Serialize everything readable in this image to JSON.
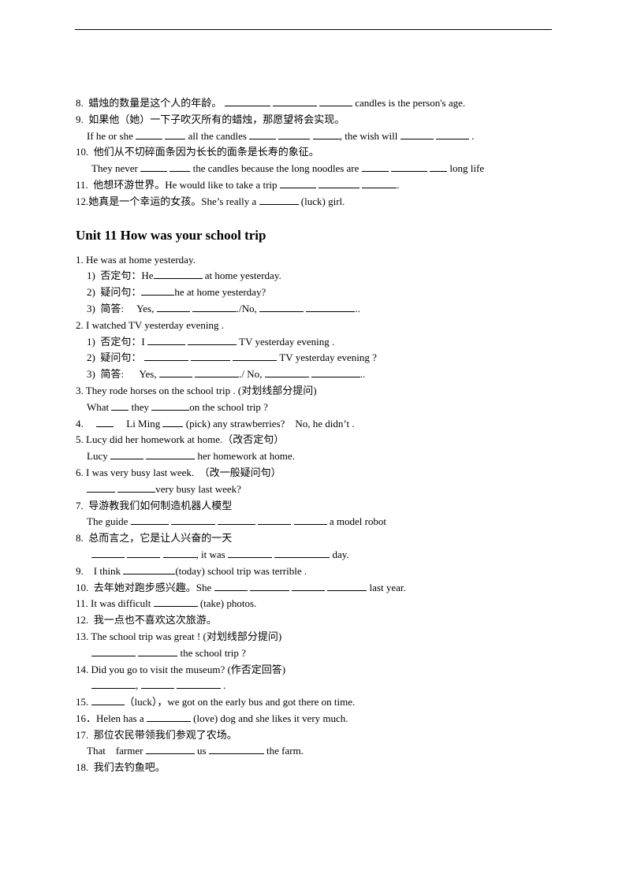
{
  "section_title": "Unit 11 How was your school trip",
  "part1": [
    {
      "indent": 0,
      "segs": [
        {
          "t": "8.  蜡烛的数量是这个人的年龄。 "
        },
        {
          "b": 58
        },
        {
          "t": " "
        },
        {
          "b": 56
        },
        {
          "t": " "
        },
        {
          "b": 42
        },
        {
          "t": " candles is the person's age."
        }
      ]
    },
    {
      "indent": 0,
      "segs": [
        {
          "t": "9.  如果他（她）一下子吹灭所有的蜡烛，那愿望将会实现。"
        }
      ]
    },
    {
      "indent": 1,
      "segs": [
        {
          "t": "If he or she "
        },
        {
          "b": 34
        },
        {
          "t": " "
        },
        {
          "b": 26
        },
        {
          "t": " all the candles "
        },
        {
          "b": 34
        },
        {
          "t": " "
        },
        {
          "b": 40
        },
        {
          "t": " "
        },
        {
          "b": 34
        },
        {
          "t": ", the wish will "
        },
        {
          "b": 42
        },
        {
          "t": " "
        },
        {
          "b": 42
        },
        {
          "t": " ."
        }
      ]
    },
    {
      "indent": 0,
      "segs": [
        {
          "t": "10.  他们从不切碎面条因为长长的面条是长寿的象征。"
        }
      ]
    },
    {
      "indent": 2,
      "segs": [
        {
          "t": "They never "
        },
        {
          "b": 34
        },
        {
          "t": " "
        },
        {
          "b": 26
        },
        {
          "t": " the candles because the long noodles are "
        },
        {
          "b": 34
        },
        {
          "t": " "
        },
        {
          "b": 46
        },
        {
          "t": " "
        },
        {
          "b": 22
        },
        {
          "t": " long life"
        }
      ]
    },
    {
      "indent": 0,
      "segs": [
        {
          "t": "11.  他想环游世界。He would like to take a trip "
        },
        {
          "b": 46
        },
        {
          "t": " "
        },
        {
          "b": 52
        },
        {
          "t": " "
        },
        {
          "b": 44
        },
        {
          "t": "."
        }
      ]
    },
    {
      "indent": 0,
      "segs": [
        {
          "t": "12.她真是一个幸运的女孩。She’s really a "
        },
        {
          "b": 50
        },
        {
          "t": " (luck) girl."
        }
      ]
    }
  ],
  "part2": [
    {
      "indent": 0,
      "segs": [
        {
          "t": "1. He was at home yesterday."
        }
      ]
    },
    {
      "indent": 1,
      "segs": [
        {
          "t": "1)  否定句：He"
        },
        {
          "b": 62
        },
        {
          "t": " at home yesterday."
        }
      ]
    },
    {
      "indent": 1,
      "segs": [
        {
          "t": "2)  疑问句："
        },
        {
          "b": 42
        },
        {
          "t": "he at home yesterday?"
        }
      ]
    },
    {
      "indent": 1,
      "segs": [
        {
          "t": "3)  简答:     Yes, "
        },
        {
          "b": 42
        },
        {
          "t": " "
        },
        {
          "b": 56
        },
        {
          "t": "./No, "
        },
        {
          "b": 56
        },
        {
          "t": " "
        },
        {
          "b": 62
        },
        {
          "t": ".."
        }
      ]
    },
    {
      "indent": 0,
      "segs": [
        {
          "t": "2. I watched TV yesterday evening ."
        }
      ]
    },
    {
      "indent": 1,
      "segs": [
        {
          "t": "1)  否定句：I "
        },
        {
          "b": 48
        },
        {
          "t": " "
        },
        {
          "b": 62
        },
        {
          "t": " TV yesterday evening ."
        }
      ]
    },
    {
      "indent": 1,
      "segs": [
        {
          "t": "2)  疑问句： "
        },
        {
          "b": 56
        },
        {
          "t": " "
        },
        {
          "b": 50
        },
        {
          "t": " "
        },
        {
          "b": 56
        },
        {
          "t": " TV yesterday evening ?"
        }
      ]
    },
    {
      "indent": 1,
      "segs": [
        {
          "t": "3)  简答:      Yes, "
        },
        {
          "b": 42
        },
        {
          "t": " "
        },
        {
          "b": 56
        },
        {
          "t": "./ No, "
        },
        {
          "b": 56
        },
        {
          "t": " "
        },
        {
          "b": 62
        },
        {
          "t": ".."
        }
      ]
    },
    {
      "indent": 0,
      "segs": [
        {
          "t": "3. They rode horses on the school trip . (对划线部分提问)"
        }
      ]
    },
    {
      "indent": 1,
      "segs": [
        {
          "t": "What "
        },
        {
          "b": 22
        },
        {
          "t": " they "
        },
        {
          "b": 48
        },
        {
          "t": "on the school trip ?"
        }
      ]
    },
    {
      "indent": 0,
      "segs": [
        {
          "t": "4.     "
        },
        {
          "b": 22
        },
        {
          "t": "     Li Ming "
        },
        {
          "b": 26
        },
        {
          "t": " (pick) any strawberries?    No, he didn’t ."
        }
      ]
    },
    {
      "indent": 0,
      "segs": [
        {
          "t": "5. Lucy did her homework at home.（改否定句）"
        }
      ]
    },
    {
      "indent": 1,
      "segs": [
        {
          "t": "Lucy "
        },
        {
          "b": 42
        },
        {
          "t": " "
        },
        {
          "b": 62
        },
        {
          "t": " her homework at home."
        }
      ]
    },
    {
      "indent": 0,
      "segs": [
        {
          "t": "6. I was very busy last week.  （改一般疑问句）"
        }
      ]
    },
    {
      "indent": 1,
      "segs": [
        {
          "t": ""
        },
        {
          "b": 36
        },
        {
          "t": " "
        },
        {
          "b": 48
        },
        {
          "t": "very busy last week?"
        }
      ]
    },
    {
      "indent": 0,
      "segs": [
        {
          "t": "7.  导游教我们如何制造机器人模型"
        }
      ]
    },
    {
      "indent": 1,
      "segs": [
        {
          "t": "The guide "
        },
        {
          "b": 48
        },
        {
          "t": " "
        },
        {
          "b": 56
        },
        {
          "t": " "
        },
        {
          "b": 48
        },
        {
          "t": " "
        },
        {
          "b": 42
        },
        {
          "t": " "
        },
        {
          "b": 42
        },
        {
          "t": " a model robot"
        }
      ]
    },
    {
      "indent": 0,
      "segs": [
        {
          "t": "8.  总而言之，它是让人兴奋的一天"
        }
      ]
    },
    {
      "indent": 2,
      "segs": [
        {
          "t": ""
        },
        {
          "b": 42
        },
        {
          "t": " "
        },
        {
          "b": 42
        },
        {
          "t": " "
        },
        {
          "b": 42
        },
        {
          "t": ", it was "
        },
        {
          "b": 56
        },
        {
          "t": " "
        },
        {
          "b": 70
        },
        {
          "t": " day."
        }
      ]
    },
    {
      "indent": 0,
      "segs": [
        {
          "t": "9.    I think "
        },
        {
          "b": 66
        },
        {
          "t": "(today) school trip was terrible ."
        }
      ]
    },
    {
      "indent": 0,
      "segs": [
        {
          "t": "10.  去年她对跑步感兴趣。She "
        },
        {
          "b": 42
        },
        {
          "t": " "
        },
        {
          "b": 50
        },
        {
          "t": " "
        },
        {
          "b": 42
        },
        {
          "t": " "
        },
        {
          "b": 50
        },
        {
          "t": " last year."
        }
      ]
    },
    {
      "indent": 0,
      "segs": [
        {
          "t": "11. It was difficult "
        },
        {
          "b": 56
        },
        {
          "t": " (take) photos."
        }
      ]
    },
    {
      "indent": 0,
      "segs": [
        {
          "t": "12.  我一点也不喜欢这次旅游。"
        }
      ]
    },
    {
      "indent": 0,
      "segs": [
        {
          "t": "13. The school trip was great ! (对划线部分提问)"
        }
      ]
    },
    {
      "indent": 2,
      "segs": [
        {
          "t": ""
        },
        {
          "b": 56
        },
        {
          "t": " "
        },
        {
          "b": 50
        },
        {
          "t": " the school trip ?"
        }
      ]
    },
    {
      "indent": 0,
      "segs": [
        {
          "t": "14. Did you go to visit the museum? (作否定回答)"
        }
      ]
    },
    {
      "indent": 2,
      "segs": [
        {
          "t": ""
        },
        {
          "b": 56
        },
        {
          "t": ", "
        },
        {
          "b": 42
        },
        {
          "t": " "
        },
        {
          "b": 56
        },
        {
          "t": " ."
        }
      ]
    },
    {
      "indent": 0,
      "segs": [
        {
          "t": "15. "
        },
        {
          "b": 42
        },
        {
          "t": "（luck），we got on the early bus and got there on time."
        }
      ]
    },
    {
      "indent": 0,
      "segs": [
        {
          "t": "16．Helen has a "
        },
        {
          "b": 56
        },
        {
          "t": " (love) dog and she likes it very much."
        }
      ]
    },
    {
      "indent": 0,
      "segs": [
        {
          "t": "17.  那位农民带领我们参观了农场。"
        }
      ]
    },
    {
      "indent": 1,
      "segs": [
        {
          "t": "That    farmer "
        },
        {
          "b": 62
        },
        {
          "t": " us "
        },
        {
          "b": 70
        },
        {
          "t": " the farm."
        }
      ]
    },
    {
      "indent": 0,
      "segs": [
        {
          "t": "18.  我们去钓鱼吧。"
        }
      ]
    }
  ]
}
